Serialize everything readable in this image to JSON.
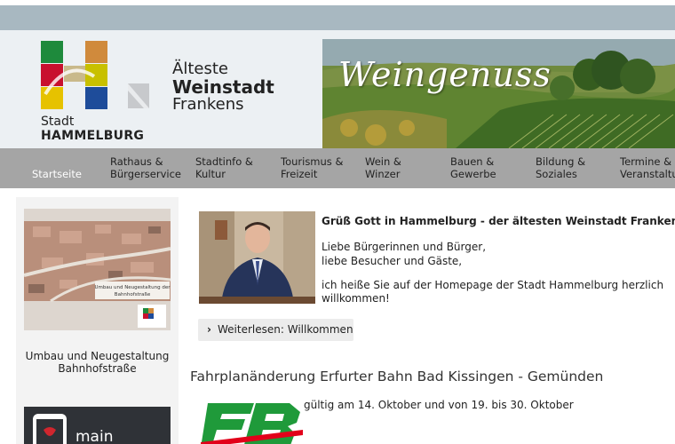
{
  "header": {
    "logo_label": "Stadt",
    "logo_name": "HAMMELBURG",
    "tagline": [
      "Älteste",
      "Weinstadt",
      "Frankens"
    ],
    "banner_title": "Weingenuss"
  },
  "nav": {
    "items": [
      {
        "label": "Startseite"
      },
      {
        "label": "Rathaus & Bürgerservice"
      },
      {
        "label": "Stadtinfo & Kultur"
      },
      {
        "label": "Tourismus & Freizeit"
      },
      {
        "label": "Wein & Winzer"
      },
      {
        "label": "Bauen & Gewerbe"
      },
      {
        "label": "Bildung & Soziales"
      },
      {
        "label": "Termine & Veranstaltungen"
      }
    ]
  },
  "sidebar": {
    "card1_image_text": "Umbau und Neugestaltung der Bahnhofstraße",
    "card1_caption": "Umbau und Neugestaltung Bahnhofstraße",
    "card2_text": "main"
  },
  "main": {
    "greeting_title": "Grüß Gott in Hammelburg - der ältesten Weinstadt Frankens!",
    "greeting_lines": [
      "Liebe Bürgerinnen und Bürger,",
      "liebe Besucher und Gäste,",
      "ich heiße Sie auf der Homepage der Stadt Hammelburg herzlich",
      "willkommen!"
    ],
    "read_more": "Weiterlesen: Willkommen",
    "news_title": "Fahrplanänderung Erfurter Bahn Bad Kissingen - Gemünden",
    "news_text": "gültig am 14. Oktober und von 19. bis 30. Oktober"
  },
  "colors": {
    "nav_bg": "#a5a5a5",
    "header_bg": "#ecf0f3",
    "topbar": "#a8b8c1",
    "eb_green": "#1f9a3a",
    "eb_red": "#e2001a"
  }
}
